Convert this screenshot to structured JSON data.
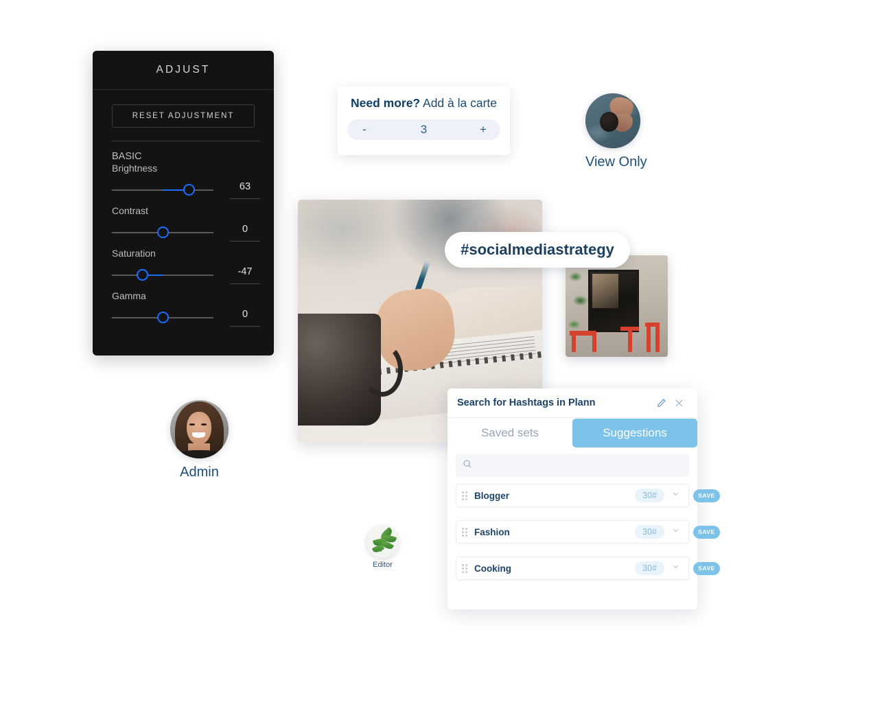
{
  "adjust_panel": {
    "title": "ADJUST",
    "reset_label": "RESET ADJUSTMENT",
    "section_label": "BASIC",
    "sliders": [
      {
        "name": "Brightness",
        "value": "63",
        "pos": 76,
        "fill_from": 50,
        "fill_to": 76
      },
      {
        "name": "Contrast",
        "value": "0",
        "pos": 50,
        "fill_from": 50,
        "fill_to": 50
      },
      {
        "name": "Saturation",
        "value": "-47",
        "pos": 30,
        "fill_from": 30,
        "fill_to": 50
      },
      {
        "name": "Gamma",
        "value": "0",
        "pos": 50,
        "fill_from": 50,
        "fill_to": 50
      }
    ]
  },
  "need_more": {
    "heading_bold": "Need more?",
    "heading_rest": " Add à la carte",
    "minus_label": "-",
    "plus_label": "+",
    "quantity": "3"
  },
  "view_only_avatar": {
    "label": "View Only"
  },
  "admin_avatar": {
    "label": "Admin"
  },
  "editor_avatar": {
    "label": "Editor"
  },
  "hashtag_pill": {
    "text": "#socialmediastrategy"
  },
  "hashtag_panel": {
    "title": "Search for Hashtags in Plann",
    "edit_icon": "pencil-icon",
    "close_icon": "close-icon",
    "tabs": [
      {
        "label": "Saved sets",
        "active": false
      },
      {
        "label": "Suggestions",
        "active": true
      }
    ],
    "search": {
      "value": "",
      "placeholder": ""
    },
    "rows": [
      {
        "name": "Blogger",
        "count": "30#",
        "save_label": "SAVE"
      },
      {
        "name": "Fashion",
        "count": "30#",
        "save_label": "SAVE"
      },
      {
        "name": "Cooking",
        "count": "30#",
        "save_label": "SAVE"
      }
    ]
  },
  "colors": {
    "accent_blue": "#7cc2e9",
    "navy_text": "#1b4268",
    "slider_blue": "#1a6dff",
    "panel_dark": "#131313"
  }
}
